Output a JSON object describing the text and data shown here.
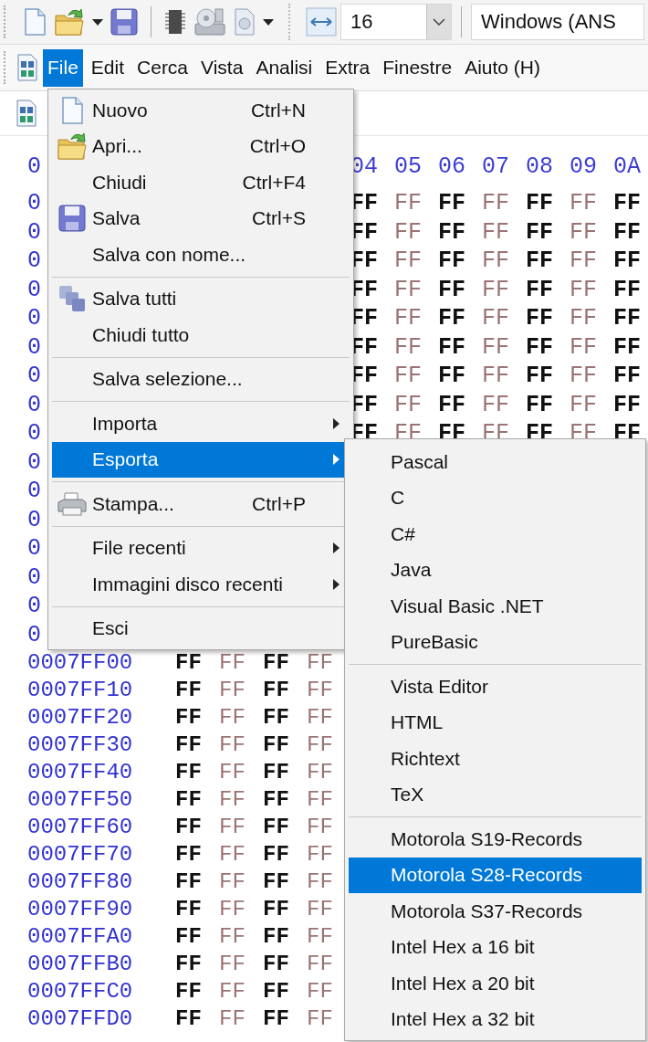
{
  "toolbar": {
    "size_field": {
      "value": "16"
    },
    "encoding_field": {
      "value": "Windows (ANS"
    }
  },
  "menu_bar": [
    {
      "label": "File",
      "selected": true
    },
    {
      "label": "Edit",
      "selected": false
    },
    {
      "label": "Cerca",
      "selected": false
    },
    {
      "label": "Vista",
      "selected": false
    },
    {
      "label": "Analisi",
      "selected": false
    },
    {
      "label": "Extra",
      "selected": false
    },
    {
      "label": "Finestre",
      "selected": false
    },
    {
      "label": "Aiuto (H)",
      "selected": false
    }
  ],
  "file_menu": {
    "items": [
      {
        "kind": "item",
        "label": "Nuovo",
        "shortcut": "Ctrl+N",
        "submenu": false,
        "selected": false
      },
      {
        "kind": "item",
        "label": "Apri...",
        "shortcut": "Ctrl+O",
        "submenu": false,
        "selected": false
      },
      {
        "kind": "item",
        "label": "Chiudi",
        "shortcut": "Ctrl+F4",
        "submenu": false,
        "selected": false
      },
      {
        "kind": "item",
        "label": "Salva",
        "shortcut": "Ctrl+S",
        "submenu": false,
        "selected": false
      },
      {
        "kind": "item",
        "label": "Salva con nome...",
        "submenu": false,
        "selected": false
      },
      {
        "kind": "separator"
      },
      {
        "kind": "item",
        "label": "Salva tutti",
        "submenu": false,
        "selected": false
      },
      {
        "kind": "item",
        "label": "Chiudi tutto",
        "submenu": false,
        "selected": false
      },
      {
        "kind": "separator"
      },
      {
        "kind": "item",
        "label": "Salva selezione...",
        "submenu": false,
        "selected": false
      },
      {
        "kind": "separator"
      },
      {
        "kind": "item",
        "label": "Importa",
        "submenu": true,
        "selected": false
      },
      {
        "kind": "item",
        "label": "Esporta",
        "submenu": true,
        "selected": true
      },
      {
        "kind": "separator"
      },
      {
        "kind": "item",
        "label": "Stampa...",
        "shortcut": "Ctrl+P",
        "submenu": false,
        "selected": false
      },
      {
        "kind": "separator"
      },
      {
        "kind": "item",
        "label": "File recenti",
        "submenu": true,
        "selected": false
      },
      {
        "kind": "item",
        "label": "Immagini disco recenti",
        "submenu": true,
        "selected": false
      },
      {
        "kind": "separator"
      },
      {
        "kind": "item",
        "label": "Esci",
        "submenu": false,
        "selected": false
      }
    ]
  },
  "export_menu": {
    "items": [
      {
        "kind": "item",
        "label": "Pascal",
        "selected": false
      },
      {
        "kind": "item",
        "label": "C",
        "selected": false
      },
      {
        "kind": "item",
        "label": "C#",
        "selected": false
      },
      {
        "kind": "item",
        "label": "Java",
        "selected": false
      },
      {
        "kind": "item",
        "label": "Visual Basic .NET",
        "selected": false
      },
      {
        "kind": "item",
        "label": "PureBasic",
        "selected": false
      },
      {
        "kind": "separator"
      },
      {
        "kind": "item",
        "label": "Vista Editor",
        "selected": false
      },
      {
        "kind": "item",
        "label": "HTML",
        "selected": false
      },
      {
        "kind": "item",
        "label": "Richtext",
        "selected": false
      },
      {
        "kind": "item",
        "label": "TeX",
        "selected": false
      },
      {
        "kind": "separator"
      },
      {
        "kind": "item",
        "label": "Motorola S19-Records",
        "selected": false
      },
      {
        "kind": "item",
        "label": "Motorola S28-Records",
        "selected": true
      },
      {
        "kind": "item",
        "label": "Motorola S37-Records",
        "selected": false
      },
      {
        "kind": "item",
        "label": "Intel Hex a 16 bit",
        "selected": false
      },
      {
        "kind": "item",
        "label": "Intel Hex a 20 bit",
        "selected": false
      },
      {
        "kind": "item",
        "label": "Intel Hex a 32 bit",
        "selected": false
      }
    ]
  },
  "hex_view": {
    "offset_label": "0",
    "column_headers": [
      "04",
      "05",
      "06",
      "07",
      "08",
      "09",
      "0A"
    ],
    "upper_rows": [
      {
        "address": "0",
        "bytes": [
          "FF",
          "FF",
          "FF",
          "FF",
          "FF",
          "FF",
          "FF"
        ]
      },
      {
        "address": "0",
        "bytes": [
          "FF",
          "FF",
          "FF",
          "FF",
          "FF",
          "FF",
          "FF"
        ]
      },
      {
        "address": "0",
        "bytes": [
          "FF",
          "FF",
          "FF",
          "FF",
          "FF",
          "FF",
          "FF"
        ]
      },
      {
        "address": "0",
        "bytes": [
          "FF",
          "FF",
          "FF",
          "FF",
          "FF",
          "FF",
          "FF"
        ]
      },
      {
        "address": "0",
        "bytes": [
          "FF",
          "FF",
          "FF",
          "FF",
          "FF",
          "FF",
          "FF"
        ]
      },
      {
        "address": "0",
        "bytes": [
          "FF",
          "FF",
          "FF",
          "FF",
          "FF",
          "FF",
          "FF"
        ]
      },
      {
        "address": "0",
        "bytes": [
          "FF",
          "FF",
          "FF",
          "FF",
          "FF",
          "FF",
          "FF"
        ]
      },
      {
        "address": "0",
        "bytes": [
          "FF",
          "FF",
          "FF",
          "FF",
          "FF",
          "FF",
          "FF"
        ]
      },
      {
        "address": "0",
        "bytes": [
          "FF",
          "FF",
          "FF",
          "FF",
          "FF",
          "FF",
          "FF"
        ]
      },
      {
        "address": "0"
      },
      {
        "address": "0"
      },
      {
        "address": "0"
      },
      {
        "address": "0"
      },
      {
        "address": "0"
      },
      {
        "address": "0"
      },
      {
        "address": "0"
      }
    ],
    "lower_rows": [
      {
        "address": "0007FF00",
        "bytes": [
          "FF",
          "FF",
          "FF",
          "FF"
        ]
      },
      {
        "address": "0007FF10",
        "bytes": [
          "FF",
          "FF",
          "FF",
          "FF"
        ]
      },
      {
        "address": "0007FF20",
        "bytes": [
          "FF",
          "FF",
          "FF",
          "FF"
        ]
      },
      {
        "address": "0007FF30",
        "bytes": [
          "FF",
          "FF",
          "FF",
          "FF"
        ]
      },
      {
        "address": "0007FF40",
        "bytes": [
          "FF",
          "FF",
          "FF",
          "FF"
        ]
      },
      {
        "address": "0007FF50",
        "bytes": [
          "FF",
          "FF",
          "FF",
          "FF"
        ]
      },
      {
        "address": "0007FF60",
        "bytes": [
          "FF",
          "FF",
          "FF",
          "FF"
        ]
      },
      {
        "address": "0007FF70",
        "bytes": [
          "FF",
          "FF",
          "FF",
          "FF"
        ]
      },
      {
        "address": "0007FF80",
        "bytes": [
          "FF",
          "FF",
          "FF",
          "FF"
        ]
      },
      {
        "address": "0007FF90",
        "bytes": [
          "FF",
          "FF",
          "FF",
          "FF"
        ]
      },
      {
        "address": "0007FFA0",
        "bytes": [
          "FF",
          "FF",
          "FF",
          "FF"
        ]
      },
      {
        "address": "0007FFB0",
        "bytes": [
          "FF",
          "FF",
          "FF",
          "FF"
        ]
      },
      {
        "address": "0007FFC0",
        "bytes": [
          "FF",
          "FF",
          "FF",
          "FF"
        ]
      },
      {
        "address": "0007FFD0",
        "bytes": [
          "FF",
          "FF",
          "FF",
          "FF"
        ]
      }
    ]
  }
}
